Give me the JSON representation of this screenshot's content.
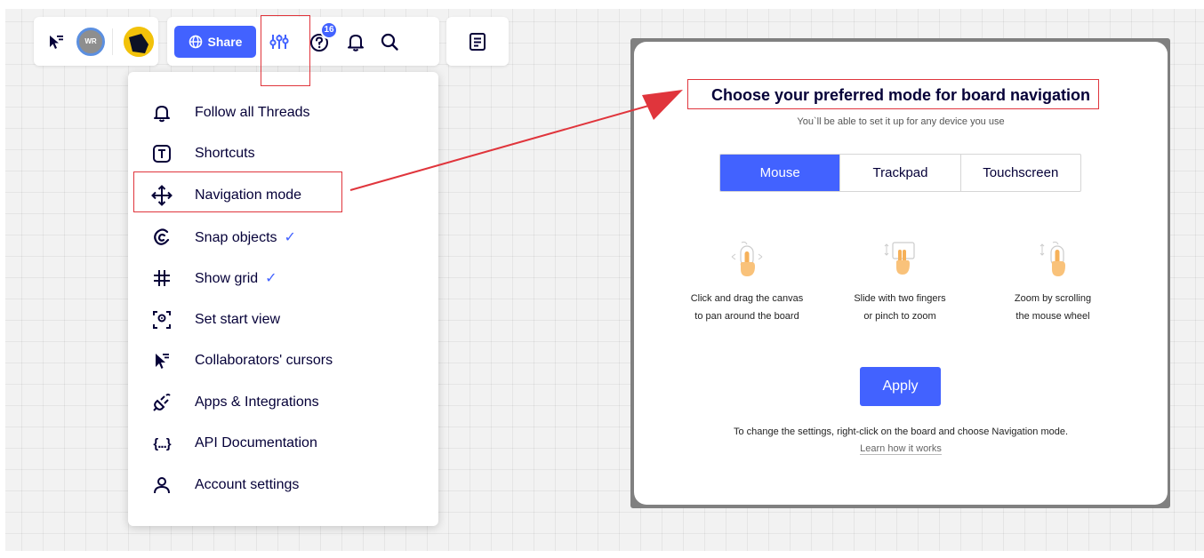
{
  "toolbar": {
    "avatar_initials": "WR",
    "share_label": "Share",
    "help_badge": "16",
    "icons": [
      "cursor-icon",
      "settings-sliders-icon",
      "help-icon",
      "bell-icon",
      "search-icon",
      "notes-icon",
      "globe-icon"
    ]
  },
  "menu": {
    "items": [
      {
        "label": "Follow all Threads",
        "icon": "bell-icon"
      },
      {
        "label": "Shortcuts",
        "icon": "shortcut-key-icon"
      },
      {
        "label": "Navigation mode",
        "icon": "move-arrows-icon"
      },
      {
        "label": "Snap objects",
        "icon": "magnet-icon",
        "check": "✓"
      },
      {
        "label": "Show grid",
        "icon": "grid-icon",
        "check": "✓"
      },
      {
        "label": "Set start view",
        "icon": "eye-frame-icon"
      },
      {
        "label": "Collaborators' cursors",
        "icon": "cursor-icon"
      },
      {
        "label": "Apps & Integrations",
        "icon": "plug-icon"
      },
      {
        "label": "API Documentation",
        "icon": "api-braces-icon",
        "glyph": "{...}"
      },
      {
        "label": "Account settings",
        "icon": "user-icon"
      }
    ]
  },
  "modal": {
    "title": "Choose your preferred mode for board navigation",
    "subtitle": "You`ll be able to set it up for any device you use",
    "tabs": [
      "Mouse",
      "Trackpad",
      "Touchscreen"
    ],
    "active_tab": "Mouse",
    "illustrations": [
      {
        "line1": "Click and drag the canvas",
        "line2": "to pan around the board"
      },
      {
        "line1": "Slide with two fingers",
        "line2": "or pinch to zoom"
      },
      {
        "line1": "Zoom by scrolling",
        "line2": "the mouse wheel"
      }
    ],
    "apply_label": "Apply",
    "footer": "To change the settings, right-click on the board and choose Navigation mode.",
    "learn_link": "Learn how it works"
  },
  "colors": {
    "accent": "#4262ff",
    "annotation_red": "#e0353c",
    "text_dark": "#050038"
  }
}
